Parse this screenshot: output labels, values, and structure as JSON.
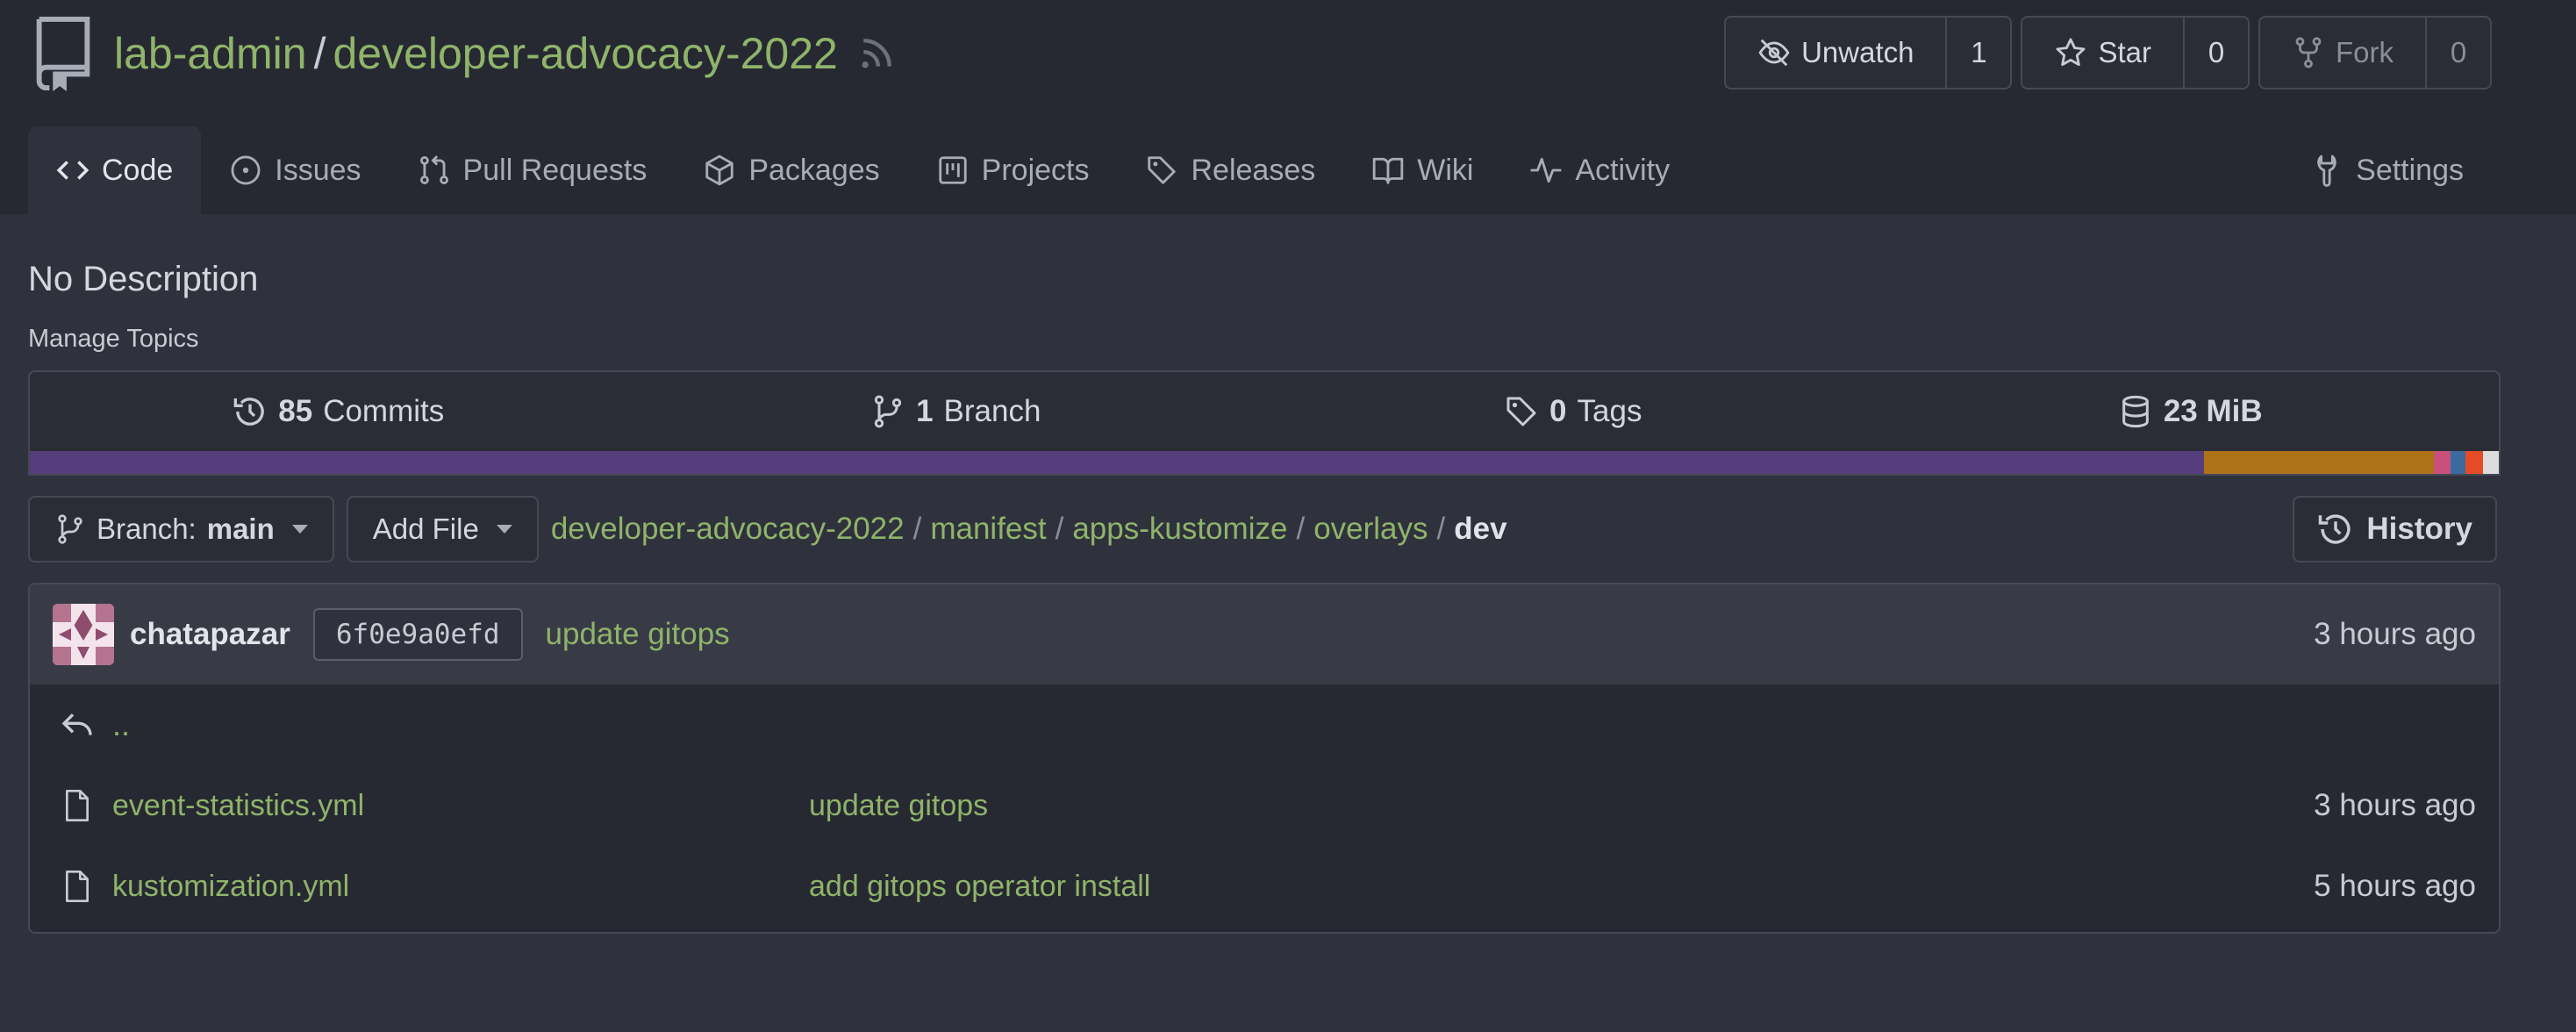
{
  "repo": {
    "owner": "lab-admin",
    "separator": "/",
    "name": "developer-advocacy-2022"
  },
  "actions": [
    {
      "label": "Unwatch",
      "count": "1",
      "icon": "eye-slash-icon",
      "disabled": false
    },
    {
      "label": "Star",
      "count": "0",
      "icon": "star-icon",
      "disabled": false
    },
    {
      "label": "Fork",
      "count": "0",
      "icon": "fork-icon",
      "disabled": true
    }
  ],
  "tabs": [
    {
      "label": "Code",
      "icon": "code-icon",
      "active": true
    },
    {
      "label": "Issues",
      "icon": "issue-icon"
    },
    {
      "label": "Pull Requests",
      "icon": "pull-request-icon"
    },
    {
      "label": "Packages",
      "icon": "package-icon"
    },
    {
      "label": "Projects",
      "icon": "project-icon"
    },
    {
      "label": "Releases",
      "icon": "tag-icon"
    },
    {
      "label": "Wiki",
      "icon": "book-icon"
    },
    {
      "label": "Activity",
      "icon": "pulse-icon"
    },
    {
      "label": "Settings",
      "icon": "tool-icon"
    }
  ],
  "description": "No Description",
  "manage_topics": "Manage Topics",
  "stats": {
    "commits": {
      "count": "85",
      "label": "Commits"
    },
    "branches": {
      "count": "1",
      "label": "Branch"
    },
    "tags": {
      "count": "0",
      "label": "Tags"
    },
    "size": {
      "count": "23 MiB",
      "label": ""
    }
  },
  "languages": [
    {
      "color": "#563d7c",
      "fraction": 0.8805
    },
    {
      "color": "#b07219",
      "fraction": 0.0932
    },
    {
      "color": "#c8507a",
      "fraction": 0.0067
    },
    {
      "color": "#3b6aa0",
      "fraction": 0.006
    },
    {
      "color": "#e34c26",
      "fraction": 0.0073
    },
    {
      "color": "#dddddd",
      "fraction": 0.0063
    }
  ],
  "branch_selector": {
    "prefix": "Branch:",
    "value": "main"
  },
  "add_file": "Add File",
  "breadcrumb": {
    "items": [
      "developer-advocacy-2022",
      "manifest",
      "apps-kustomize",
      "overlays"
    ],
    "separator": "/",
    "current": "dev"
  },
  "history": "History",
  "latest_commit": {
    "author": "chatapazar",
    "sha": "6f0e9a0efd",
    "message": "update gitops",
    "time": "3 hours ago"
  },
  "parent_dir": "..",
  "files": [
    {
      "name": "event-statistics.yml",
      "message": "update gitops",
      "time": "3 hours ago"
    },
    {
      "name": "kustomization.yml",
      "message": "add gitops operator install",
      "time": "5 hours ago"
    }
  ]
}
